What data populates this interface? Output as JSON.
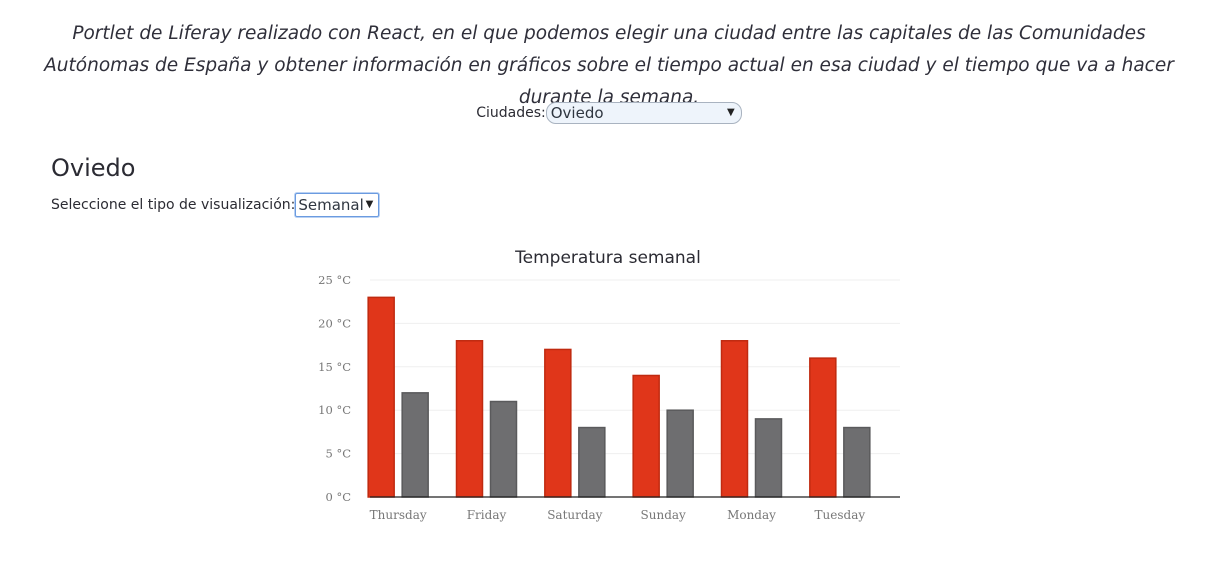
{
  "intro_text": "Portlet de Liferay realizado con React, en el que podemos elegir una ciudad entre las capitales de las Comunidades Autónomas de España y obtener información en gráficos sobre el tiempo actual en esa ciudad y el tiempo que va a hacer durante la semana.",
  "city_selector": {
    "label": "Ciudades:",
    "value": "Oviedo"
  },
  "city_heading": "Oviedo",
  "visualization_selector": {
    "label": "Seleccione el tipo de visualización:",
    "value": "Semanal"
  },
  "colors": {
    "series_max": "#e0361a",
    "series_min": "#6e6e70"
  },
  "chart_data": {
    "type": "bar",
    "title": "Temperatura semanal",
    "categories": [
      "Thursday",
      "Friday",
      "Saturday",
      "Sunday",
      "Monday",
      "Tuesday"
    ],
    "series": [
      {
        "values": [
          23,
          18,
          17,
          14,
          18,
          16
        ]
      },
      {
        "values": [
          12,
          11,
          8,
          10,
          9,
          8
        ]
      }
    ],
    "yticks": [
      "0 °C",
      "5 °C",
      "10 °C",
      "15 °C",
      "20 °C",
      "25 °C"
    ],
    "ylim": [
      0,
      25
    ],
    "grid": true,
    "legend": "none"
  }
}
